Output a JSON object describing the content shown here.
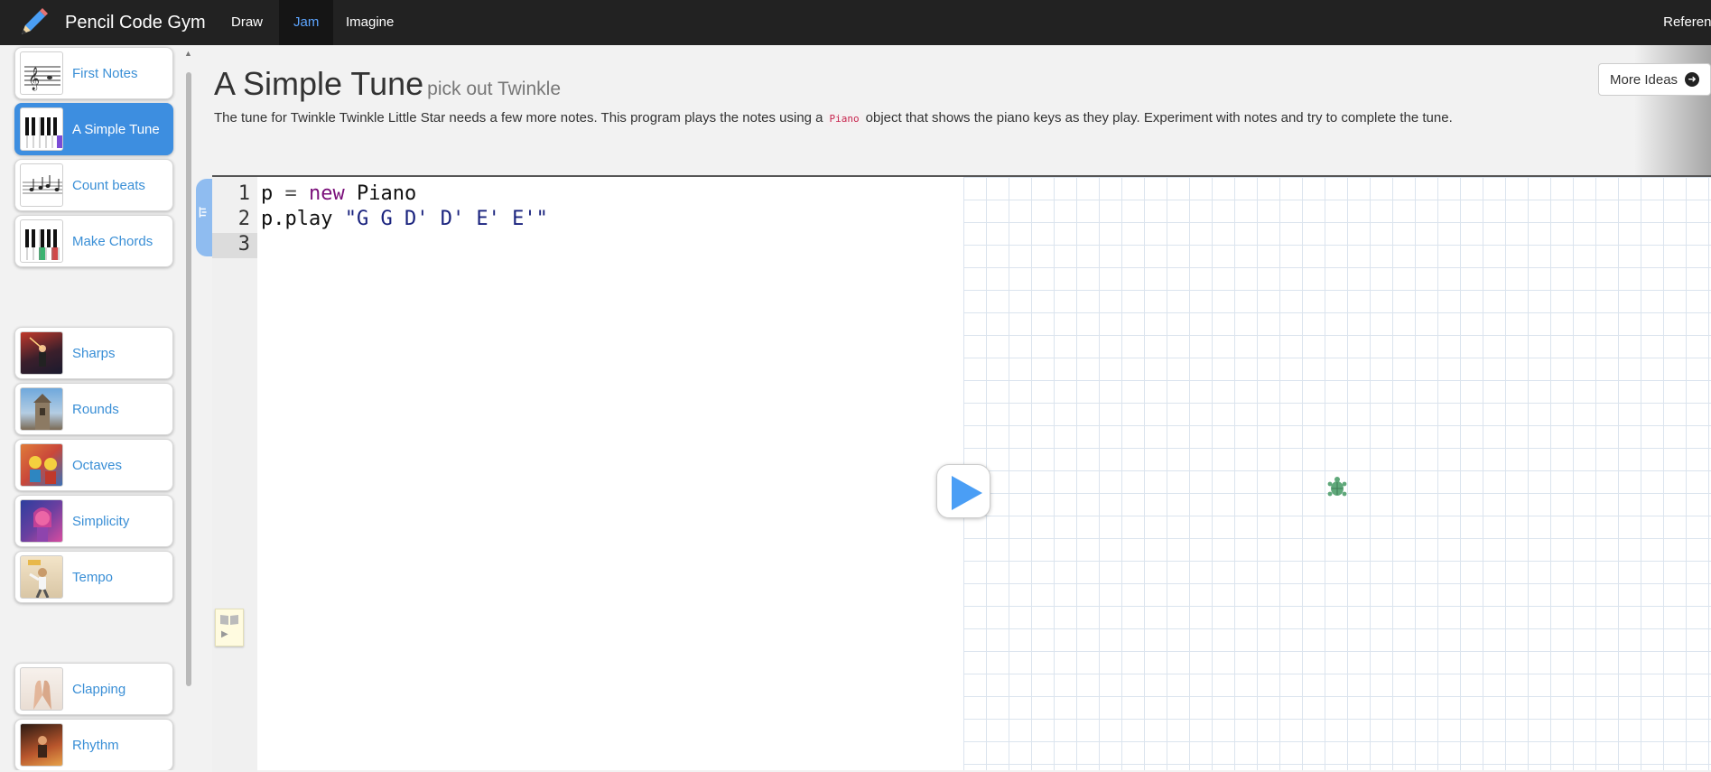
{
  "navbar": {
    "brand": "Pencil Code Gym",
    "items": [
      {
        "label": "Draw",
        "active": false
      },
      {
        "label": "Jam",
        "active": true
      },
      {
        "label": "Imagine",
        "active": false
      }
    ],
    "reference": "Referenc"
  },
  "sidebar": {
    "lessons": [
      {
        "label": "First Notes",
        "thumb": "sheet-music-thumb",
        "active": false
      },
      {
        "label": "A Simple Tune",
        "thumb": "piano-keys-thumb",
        "active": true
      },
      {
        "label": "Count beats",
        "thumb": "notes-staff-thumb",
        "active": false
      },
      {
        "label": "Make Chords",
        "thumb": "piano-chords-thumb",
        "active": false
      },
      {
        "label": "Sharps",
        "thumb": "concert-photo-thumb",
        "active": false
      },
      {
        "label": "Rounds",
        "thumb": "tower-photo-thumb",
        "active": false
      },
      {
        "label": "Octaves",
        "thumb": "lego-photo-thumb",
        "active": false
      },
      {
        "label": "Simplicity",
        "thumb": "cartoon-photo-thumb",
        "active": false
      },
      {
        "label": "Tempo",
        "thumb": "dancer-photo-thumb",
        "active": false
      },
      {
        "label": "Clapping",
        "thumb": "hands-photo-thumb",
        "active": false
      },
      {
        "label": "Rhythm",
        "thumb": "drummer-photo-thumb",
        "active": false
      }
    ]
  },
  "header": {
    "title": "A Simple Tune",
    "subtitle": "pick out Twinkle",
    "desc_before": "The tune for Twinkle Twinkle Little Star needs a few more notes. This program plays the notes using a",
    "desc_code": "Piano",
    "desc_after": "object that shows the piano keys as they play. Experiment with notes and try to complete the tune.",
    "more_ideas": "More Ideas",
    "more_ideas_icon": "arrow-circle-right-icon"
  },
  "editor": {
    "line_numbers": [
      "1",
      "2",
      "3"
    ],
    "current_line": 3,
    "line1": {
      "var": "p",
      "op": "=",
      "kw": "new",
      "cls": "Piano"
    },
    "line2": {
      "call": "p.play",
      "str": "\"G G D' D' E' E'\""
    }
  },
  "colors": {
    "accent": "#3d8ee0",
    "navbar": "#222222",
    "active_nav_text": "#5da5ff",
    "keyword": "#7a0f7a",
    "string": "#1a237e",
    "run_button": "#4a9ef5",
    "turtle": "#5fa87a"
  }
}
